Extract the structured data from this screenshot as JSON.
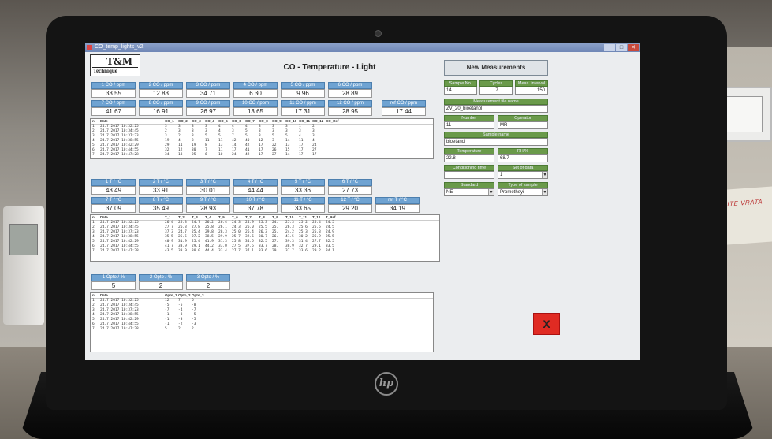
{
  "window": {
    "title": "CO_temp_lights_v2",
    "min": "_",
    "max": "□",
    "close": "✕"
  },
  "logo": {
    "big": "T&M",
    "small": "Technique"
  },
  "app_title": "CO - Temperature - Light",
  "co_row1": [
    {
      "label": "1 CO / ppm",
      "value": "33.55"
    },
    {
      "label": "2 CO / ppm",
      "value": "12.83"
    },
    {
      "label": "3 CO / ppm",
      "value": "34.71"
    },
    {
      "label": "4 CO / ppm",
      "value": "6.30"
    },
    {
      "label": "5 CO / ppm",
      "value": "9.96"
    },
    {
      "label": "6 CO / ppm",
      "value": "28.89"
    }
  ],
  "co_row2": [
    {
      "label": "7 CO / ppm",
      "value": "41.67"
    },
    {
      "label": "8 CO / ppm",
      "value": "16.91"
    },
    {
      "label": "9 CO / ppm",
      "value": "26.97"
    },
    {
      "label": "10 CO / ppm",
      "value": "13.65"
    },
    {
      "label": "11 CO / ppm",
      "value": "17.31"
    },
    {
      "label": "12 CO / ppm",
      "value": "28.95"
    },
    {
      "label": "ref CO / ppm",
      "value": "17.44"
    }
  ],
  "co_table": {
    "headers": [
      "n",
      "Date",
      "CO_1",
      "CO_2",
      "CO_3",
      "CO_4",
      "CO_5",
      "CO_6",
      "CO_7",
      "CO_8",
      "CO_9",
      "CO_10",
      "CO_11",
      "CO_12",
      "CO_Ref"
    ],
    "rows": [
      [
        "1",
        "24.7.2017 10:32:25",
        "3",
        "3",
        "3",
        "3",
        "4",
        "4",
        "4",
        "3",
        "3",
        "3",
        "1",
        "2"
      ],
      [
        "2",
        "24.7.2017 10:34:45",
        "2",
        "3",
        "3",
        "3",
        "4",
        "3",
        "5",
        "3",
        "3",
        "3",
        "3",
        "3"
      ],
      [
        "3",
        "24.7.2017 10:37:23",
        "3",
        "2",
        "3",
        "5",
        "5",
        "7",
        "5",
        "3",
        "5",
        "5",
        "4",
        "3"
      ],
      [
        "4",
        "24.7.2017 10:38:55",
        "19",
        "4",
        "3",
        "11",
        "11",
        "42",
        "40",
        "12",
        "3",
        "14",
        "11",
        "4"
      ],
      [
        "5",
        "24.7.2017 10:42:29",
        "29",
        "11",
        "19",
        "8",
        "13",
        "14",
        "42",
        "17",
        "22",
        "13",
        "17",
        "24"
      ],
      [
        "6",
        "24.7.2017 10:44:55",
        "32",
        "12",
        "30",
        "7",
        "11",
        "17",
        "41",
        "17",
        "26",
        "15",
        "17",
        "27"
      ],
      [
        "7",
        "24.7.2017 10:47:28",
        "34",
        "13",
        "25",
        "6",
        "10",
        "24",
        "42",
        "17",
        "27",
        "14",
        "17",
        "17"
      ]
    ]
  },
  "t_row1": [
    {
      "label": "1 T / °C",
      "value": "43.49"
    },
    {
      "label": "2 T / °C",
      "value": "33.91"
    },
    {
      "label": "3 T / °C",
      "value": "30.01"
    },
    {
      "label": "4 T / °C",
      "value": "44.44"
    },
    {
      "label": "5 T / °C",
      "value": "33.36"
    },
    {
      "label": "6 T / °C",
      "value": "27.73"
    }
  ],
  "t_row2": [
    {
      "label": "7 T / °C",
      "value": "37.09"
    },
    {
      "label": "8 T / °C",
      "value": "35.49"
    },
    {
      "label": "9 T / °C",
      "value": "28.93"
    },
    {
      "label": "10 T / °C",
      "value": "37.78"
    },
    {
      "label": "11 T / °C",
      "value": "33.65"
    },
    {
      "label": "12 T / °C",
      "value": "29.20"
    },
    {
      "label": "ref T / °C",
      "value": "34.19"
    }
  ],
  "t_table": {
    "headers": [
      "n",
      "Date",
      "T_1",
      "T_2",
      "T_3",
      "T_4",
      "T_5",
      "T_6",
      "T_7",
      "T_8",
      "T_9",
      "T_10",
      "T_11",
      "T_12",
      "T_Ref"
    ],
    "rows": [
      [
        "1",
        "24.7.2017 10:32:25",
        "26.4",
        "25.3",
        "24.7",
        "26.2",
        "26.4",
        "24.3",
        "24.9",
        "25.3",
        "24.",
        "25.3",
        "25.2",
        "25.4",
        "24.5"
      ],
      [
        "2",
        "24.7.2017 10:34:45",
        "27.7",
        "26.3",
        "27.8",
        "25.8",
        "26.1",
        "24.3",
        "26.0",
        "25.5",
        "25.",
        "26.3",
        "25.6",
        "25.5",
        "24.5"
      ],
      [
        "3",
        "24.7.2017 10:37:23",
        "37.3",
        "24.7",
        "25.4",
        "29.8",
        "28.3",
        "25.0",
        "26.4",
        "26.3",
        "25.",
        "24.2",
        "25.3",
        "25.3",
        "24.9"
      ],
      [
        "4",
        "24.7.2017 10:38:55",
        "35.5",
        "25.5",
        "27.2",
        "38.5",
        "29.9",
        "25.7",
        "32.6",
        "30.7",
        "26.",
        "41.5",
        "30.2",
        "26.9",
        "25.5"
      ],
      [
        "5",
        "24.7.2017 10:42:29",
        "40.9",
        "31.9",
        "25.4",
        "41.9",
        "31.3",
        "25.8",
        "34.5",
        "32.5",
        "27.",
        "39.3",
        "31.4",
        "27.7",
        "32.5"
      ],
      [
        "6",
        "24.7.2017 10:44:55",
        "41.7",
        "33.9",
        "29.1",
        "44.2",
        "33.0",
        "27.5",
        "37.5",
        "33.7",
        "28.",
        "38.9",
        "32.7",
        "29.1",
        "33.5"
      ],
      [
        "7",
        "24.7.2017 10:47:28",
        "43.5",
        "33.9",
        "30.0",
        "44.4",
        "33.4",
        "27.7",
        "37.1",
        "33.6",
        "29.",
        "37.7",
        "33.6",
        "29.2",
        "34.1"
      ]
    ]
  },
  "opto_row": [
    {
      "label": "1 Opto / %",
      "value": "5"
    },
    {
      "label": "2 Opto / %",
      "value": "2"
    },
    {
      "label": "3 Opto / %",
      "value": "2"
    }
  ],
  "opto_table": {
    "headers": [
      "n",
      "Date",
      "Opto_1",
      "Opto_2",
      "Opto_3"
    ],
    "rows": [
      [
        "1",
        "24.7.2017 10:32:25",
        "12",
        "7",
        "6"
      ],
      [
        "2",
        "24.7.2017 10:34:45",
        "-5",
        "-5",
        "-8"
      ],
      [
        "3",
        "24.7.2017 10:37:23",
        "-7",
        "-4",
        "-7"
      ],
      [
        "4",
        "24.7.2017 10:38:55",
        "-1",
        "-3",
        "-5"
      ],
      [
        "5",
        "24.7.2017 10:42:29",
        "-1",
        "-3",
        "-5"
      ],
      [
        "6",
        "24.7.2017 10:44:55",
        "-1",
        "-2",
        "-3"
      ],
      [
        "7",
        "24.7.2017 10:47:28",
        "5",
        "2",
        "2"
      ]
    ]
  },
  "right_panel": {
    "new_measurements": "New Measurements",
    "rowA": [
      {
        "label": "Sample No.",
        "value": "14"
      },
      {
        "label": "Cycles",
        "value": "7"
      },
      {
        "label": "Meas. interval",
        "value": "150"
      }
    ],
    "file_label": "Measurement file name",
    "file_value": "ZV_20_bioetanol",
    "rowB": [
      {
        "label": "Number",
        "value": "11"
      },
      {
        "label": "Operator",
        "value": "MR"
      }
    ],
    "sample_label": "Sample name",
    "sample_value": "bioetanol",
    "rowC": [
      {
        "label": "Temperature",
        "value": "22.8"
      },
      {
        "label": "RH/%",
        "value": "68.7"
      }
    ],
    "rowD": [
      {
        "label": "Conditioning time",
        "value": ""
      },
      {
        "label": "Set of data",
        "value": "1"
      }
    ],
    "rowE": [
      {
        "label": "Standard",
        "value": "NE"
      },
      {
        "label": "Type of sample",
        "value": "Prometheyi"
      }
    ]
  },
  "exit_label": "X",
  "hp_label": "hp",
  "poster_text": "PARCALITE VRATA"
}
